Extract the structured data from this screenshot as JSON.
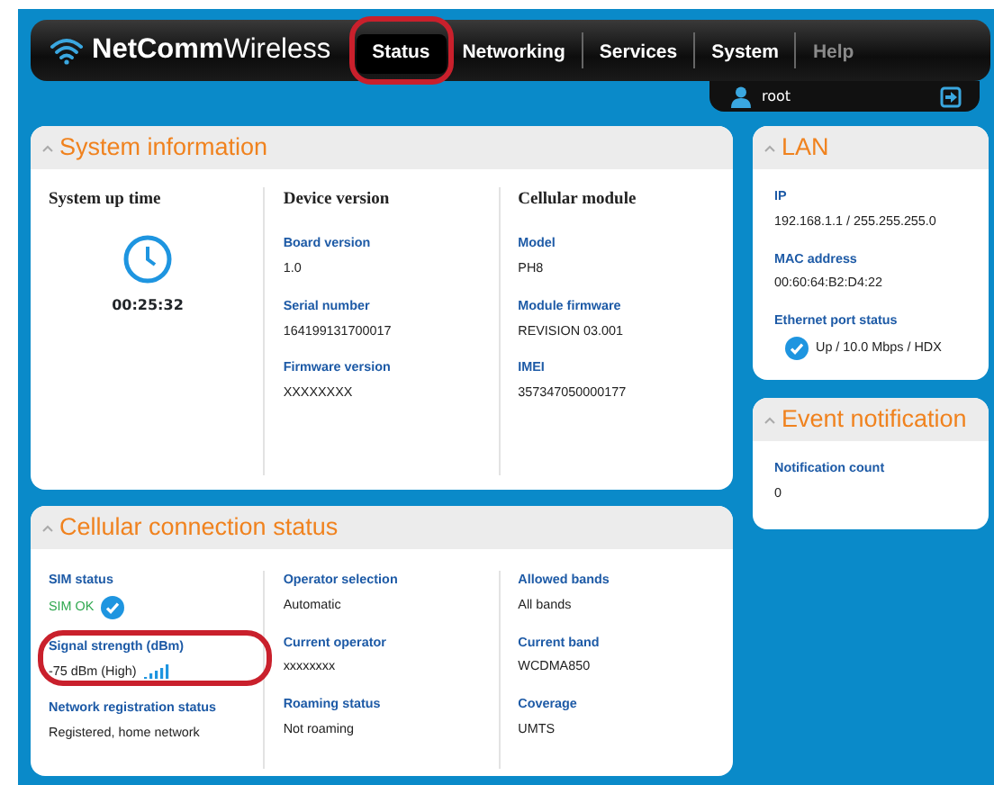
{
  "brand": {
    "bold": "NetComm",
    "light": "Wireless"
  },
  "nav": [
    {
      "label": "Status",
      "selected": true,
      "disabled": false,
      "highlighted": true
    },
    {
      "label": "Networking",
      "selected": false,
      "disabled": false,
      "highlighted": false
    },
    {
      "label": "Services",
      "selected": false,
      "disabled": false,
      "highlighted": false
    },
    {
      "label": "System",
      "selected": false,
      "disabled": false,
      "highlighted": false
    },
    {
      "label": "Help",
      "selected": false,
      "disabled": true,
      "highlighted": false
    }
  ],
  "user": {
    "name": "root"
  },
  "system_information": {
    "title": "System information",
    "columns": [
      {
        "heading": "System up time",
        "kind": "uptime",
        "uptime": "00:25:32"
      },
      {
        "heading": "Device version",
        "kind": "fields",
        "fields": [
          {
            "label": "Board version",
            "value": "1.0"
          },
          {
            "label": "Serial number",
            "value": "164199131700017"
          },
          {
            "label": "Firmware version",
            "value": "XXXXXXXX"
          }
        ]
      },
      {
        "heading": "Cellular module",
        "kind": "fields",
        "fields": [
          {
            "label": "Model",
            "value": "PH8"
          },
          {
            "label": "Module firmware",
            "value": "REVISION 03.001"
          },
          {
            "label": "IMEI",
            "value": "357347050000177"
          }
        ]
      }
    ]
  },
  "cellular_connection_status": {
    "title": "Cellular connection status",
    "columns": [
      [
        {
          "label": "SIM status",
          "value": "SIM OK",
          "kind": "ok",
          "highlighted": false
        },
        {
          "label": "Signal strength (dBm)",
          "value": "-75 dBm (High)",
          "kind": "signal",
          "highlighted": true
        },
        {
          "label": "Network registration status",
          "value": "Registered, home network",
          "highlighted": false
        }
      ],
      [
        {
          "label": "Operator selection",
          "value": "Automatic",
          "highlighted": false
        },
        {
          "label": "Current operator",
          "value": "xxxxxxxx",
          "highlighted": false
        },
        {
          "label": "Roaming status",
          "value": "Not roaming",
          "highlighted": false
        }
      ],
      [
        {
          "label": "Allowed bands",
          "value": "All bands",
          "highlighted": false
        },
        {
          "label": "Current band",
          "value": "WCDMA850",
          "highlighted": false
        },
        {
          "label": "Coverage",
          "value": "UMTS",
          "highlighted": false
        }
      ]
    ]
  },
  "lan": {
    "title": "LAN",
    "fields": [
      {
        "label": "IP",
        "value": "192.168.1.1 / 255.255.255.0"
      },
      {
        "label": "MAC address",
        "value": "00:60:64:B2:D4:22"
      },
      {
        "label": "Ethernet port status",
        "value": "Up / 10.0 Mbps / HDX",
        "kind": "status"
      }
    ]
  },
  "event_notification": {
    "title": "Event notification",
    "fields": [
      {
        "label": "Notification count",
        "value": "0"
      }
    ]
  }
}
